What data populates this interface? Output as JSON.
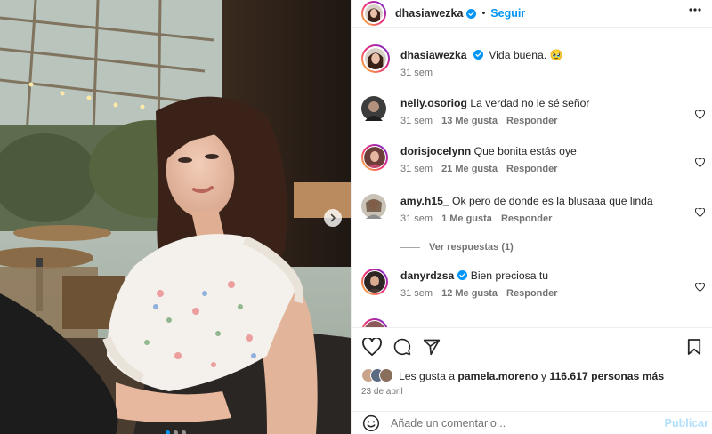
{
  "post": {
    "author": "dhasiawezka",
    "follow_label": "Seguir",
    "separator": "•",
    "caption_user": "dhasiawezka",
    "caption_text": "Vida buena. 🥹",
    "caption_time": "31 sem"
  },
  "comments": [
    {
      "user": "nelly.osoriog",
      "text": "La verdad no le sé señor",
      "time": "31 sem",
      "likes": "13 Me gusta",
      "reply": "Responder",
      "verified": false
    },
    {
      "user": "dorisjocelynn",
      "text": "Que bonita estás oye",
      "time": "31 sem",
      "likes": "21 Me gusta",
      "reply": "Responder",
      "verified": false
    },
    {
      "user": "amy.h15_",
      "text": "Ok pero de donde es la blusaaa que linda",
      "time": "31 sem",
      "likes": "1 Me gusta",
      "reply": "Responder",
      "verified": false
    },
    {
      "user": "danyrdzsa",
      "text": "Bien preciosa tu",
      "time": "31 sem",
      "likes": "12 Me gusta",
      "reply": "Responder",
      "verified": true
    }
  ],
  "view_replies": "Ver respuestas (1)",
  "likes": {
    "prefix": "Les gusta a",
    "user": "pamela.moreno",
    "conj": "y",
    "count": "116.617 personas más"
  },
  "date": "23 de abril",
  "composer": {
    "placeholder": "Añade un comentario...",
    "post_label": "Publicar"
  },
  "colors": {
    "accent": "#0095f6",
    "verified": "#0095f6"
  },
  "icons": {
    "more": "more-horizontal-icon",
    "like": "heart-icon",
    "comment": "comment-icon",
    "share": "send-icon",
    "save": "bookmark-icon",
    "emoji": "emoji-icon",
    "next": "chevron-right-icon"
  },
  "carousel": {
    "slide": 1,
    "total": 3
  }
}
